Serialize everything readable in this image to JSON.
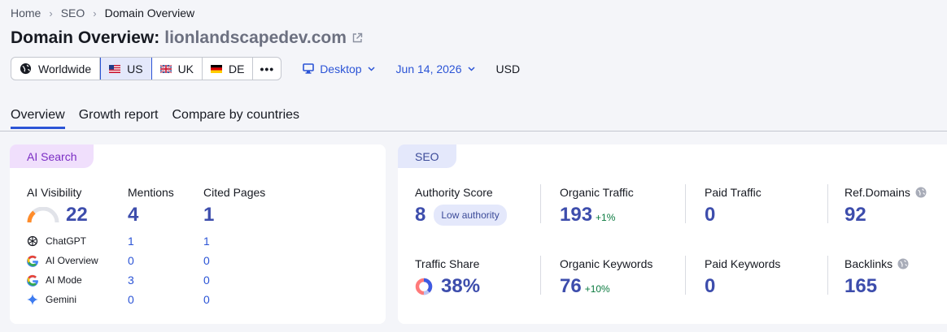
{
  "breadcrumb": [
    "Home",
    "SEO",
    "Domain Overview"
  ],
  "title": {
    "prefix": "Domain Overview:",
    "domain": "lionlandscapedev.com"
  },
  "filters": {
    "databases": [
      "Worldwide",
      "US",
      "UK",
      "DE"
    ],
    "active_database": "US",
    "more": "•••",
    "device": "Desktop",
    "date": "Jun 14, 2026",
    "currency": "USD"
  },
  "tabs": [
    "Overview",
    "Growth report",
    "Compare by countries"
  ],
  "ai_search": {
    "tag": "AI Search",
    "visibility_label": "AI Visibility",
    "visibility_value": "22",
    "mentions_label": "Mentions",
    "mentions_value": "4",
    "cited_label": "Cited Pages",
    "cited_value": "1",
    "rows": [
      {
        "name": "ChatGPT",
        "mentions": "1",
        "cited": "1"
      },
      {
        "name": "AI Overview",
        "mentions": "0",
        "cited": "0"
      },
      {
        "name": "AI Mode",
        "mentions": "3",
        "cited": "0"
      },
      {
        "name": "Gemini",
        "mentions": "0",
        "cited": "0"
      }
    ]
  },
  "seo": {
    "tag": "SEO",
    "authority_label": "Authority Score",
    "authority_value": "8",
    "authority_badge": "Low authority",
    "organic_traffic_label": "Organic Traffic",
    "organic_traffic_value": "193",
    "organic_traffic_delta": "+1%",
    "paid_traffic_label": "Paid Traffic",
    "paid_traffic_value": "0",
    "ref_domains_label": "Ref.Domains",
    "ref_domains_value": "92",
    "traffic_share_label": "Traffic Share",
    "traffic_share_value": "38%",
    "organic_keywords_label": "Organic Keywords",
    "organic_keywords_value": "76",
    "organic_keywords_delta": "+10%",
    "paid_keywords_label": "Paid Keywords",
    "paid_keywords_value": "0",
    "backlinks_label": "Backlinks",
    "backlinks_value": "165"
  },
  "colors": {
    "accent": "#2b54d6",
    "value": "#3d4dac",
    "positive": "#0a7a3f",
    "ai_tag": "#f0dffc",
    "seo_tag": "#e4e8fb"
  }
}
